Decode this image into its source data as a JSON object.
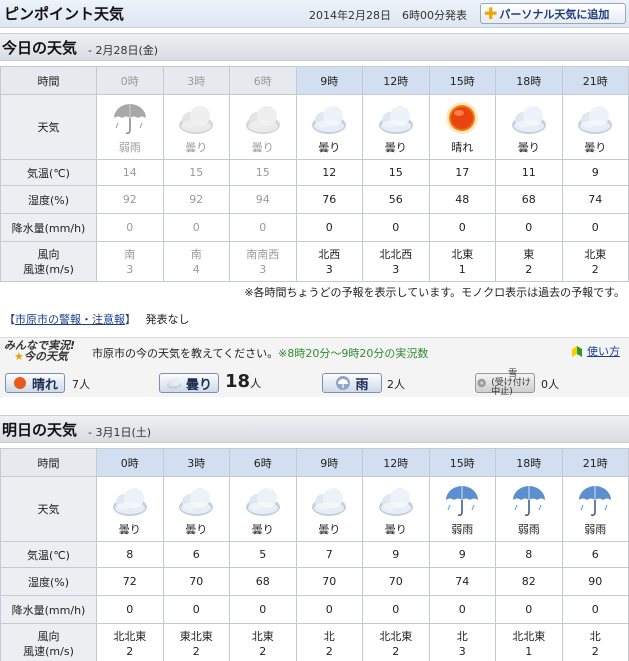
{
  "header": {
    "title": "ピンポイント天気",
    "issued": "2014年2月28日　6時00分発表",
    "add_button": "パーソナル天気に追加"
  },
  "today": {
    "heading": "今日の天気",
    "date": "- 2月28日(金)",
    "labels": {
      "time": "時間",
      "weather": "天気",
      "temp": "気温(℃)",
      "humidity": "湿度(%)",
      "precip": "降水量(mm/h)",
      "wind_dir": "風向",
      "wind_speed": "風速(m/s)"
    },
    "columns": [
      {
        "time": "0時",
        "weather": "弱雨",
        "icon": "rain-umbrella-icon",
        "temp": "14",
        "humidity": "92",
        "precip": "0",
        "wind_dir": "南",
        "wind_speed": "3",
        "past": true
      },
      {
        "time": "3時",
        "weather": "曇り",
        "icon": "cloud-icon",
        "temp": "15",
        "humidity": "92",
        "precip": "0",
        "wind_dir": "南",
        "wind_speed": "4",
        "past": true
      },
      {
        "time": "6時",
        "weather": "曇り",
        "icon": "cloud-icon",
        "temp": "15",
        "humidity": "94",
        "precip": "0",
        "wind_dir": "南南西",
        "wind_speed": "3",
        "past": true
      },
      {
        "time": "9時",
        "weather": "曇り",
        "icon": "cloud-icon",
        "temp": "12",
        "humidity": "76",
        "precip": "0",
        "wind_dir": "北西",
        "wind_speed": "3",
        "past": false
      },
      {
        "time": "12時",
        "weather": "曇り",
        "icon": "cloud-icon",
        "temp": "15",
        "humidity": "56",
        "precip": "0",
        "wind_dir": "北北西",
        "wind_speed": "3",
        "past": false
      },
      {
        "time": "15時",
        "weather": "晴れ",
        "icon": "sun-icon",
        "temp": "17",
        "humidity": "48",
        "precip": "0",
        "wind_dir": "北東",
        "wind_speed": "1",
        "past": false
      },
      {
        "time": "18時",
        "weather": "曇り",
        "icon": "cloud-icon",
        "temp": "11",
        "humidity": "68",
        "precip": "0",
        "wind_dir": "東",
        "wind_speed": "2",
        "past": false
      },
      {
        "time": "21時",
        "weather": "曇り",
        "icon": "cloud-icon",
        "temp": "9",
        "humidity": "74",
        "precip": "0",
        "wind_dir": "北東",
        "wind_speed": "2",
        "past": false
      }
    ],
    "note": "※各時間ちょうどの予報を表示しています。モノクロ表示は過去の予報です。"
  },
  "alerts": {
    "bracket_open": "【",
    "link": "市原市の警報・注意報",
    "bracket_close": "】",
    "status": "発表なし"
  },
  "minna": {
    "logo_line1": "みんなで実況!",
    "logo_line2": "今の天気",
    "ask": "市原市の今の天気を教えてください。",
    "range": "※8時20分〜9時20分の実況数",
    "howto": "使い方",
    "votes": [
      {
        "label": "晴れ",
        "count": "7",
        "unit": "人"
      },
      {
        "label": "曇り",
        "count": "18",
        "unit": "人"
      },
      {
        "label": "雨",
        "count": "2",
        "unit": "人"
      },
      {
        "label_line1": "雪",
        "label_line2": "(受け付け中止)",
        "count": "0",
        "unit": "人"
      }
    ]
  },
  "tomorrow": {
    "heading": "明日の天気",
    "date": "- 3月1日(土)",
    "columns": [
      {
        "time": "0時",
        "weather": "曇り",
        "icon": "cloud-icon",
        "temp": "8",
        "humidity": "72",
        "precip": "0",
        "wind_dir": "北北東",
        "wind_speed": "2"
      },
      {
        "time": "3時",
        "weather": "曇り",
        "icon": "cloud-icon",
        "temp": "6",
        "humidity": "70",
        "precip": "0",
        "wind_dir": "東北東",
        "wind_speed": "2"
      },
      {
        "time": "6時",
        "weather": "曇り",
        "icon": "cloud-icon",
        "temp": "5",
        "humidity": "68",
        "precip": "0",
        "wind_dir": "北東",
        "wind_speed": "2"
      },
      {
        "time": "9時",
        "weather": "曇り",
        "icon": "cloud-icon",
        "temp": "7",
        "humidity": "70",
        "precip": "0",
        "wind_dir": "北",
        "wind_speed": "2"
      },
      {
        "time": "12時",
        "weather": "曇り",
        "icon": "cloud-icon",
        "temp": "9",
        "humidity": "70",
        "precip": "0",
        "wind_dir": "北北東",
        "wind_speed": "2"
      },
      {
        "time": "15時",
        "weather": "弱雨",
        "icon": "rain-umbrella-icon",
        "temp": "9",
        "humidity": "74",
        "precip": "0",
        "wind_dir": "北",
        "wind_speed": "3"
      },
      {
        "time": "18時",
        "weather": "弱雨",
        "icon": "rain-umbrella-icon",
        "temp": "8",
        "humidity": "82",
        "precip": "0",
        "wind_dir": "北北東",
        "wind_speed": "1"
      },
      {
        "time": "21時",
        "weather": "弱雨",
        "icon": "rain-umbrella-icon",
        "temp": "6",
        "humidity": "90",
        "precip": "0",
        "wind_dir": "北",
        "wind_speed": "2"
      }
    ]
  }
}
